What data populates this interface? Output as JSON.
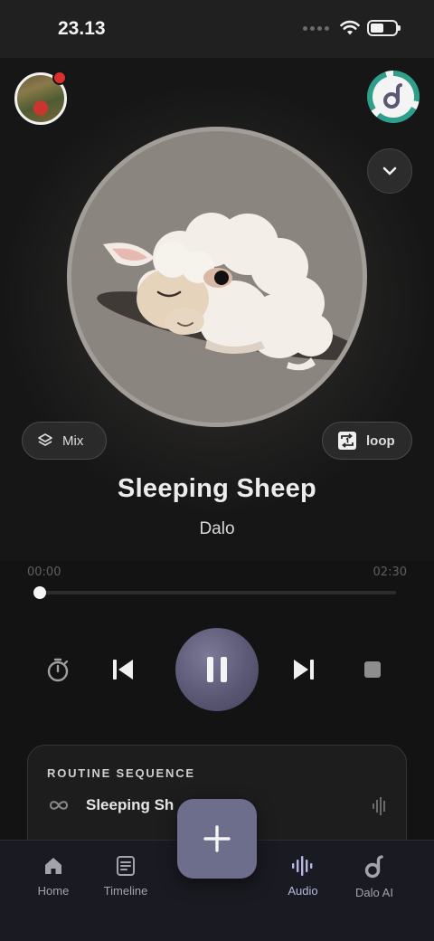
{
  "status_bar": {
    "time": "23.13"
  },
  "header": {
    "avatar_icon": "profile-photo",
    "notification_dot": true,
    "brand_icon": "dalo-logo-icon",
    "collapse_icon": "chevron-down-icon"
  },
  "player": {
    "artwork_icon": "sleeping-sheep-illustration",
    "mix_label": "Mix",
    "loop_label": "loop",
    "title": "Sleeping Sheep",
    "artist": "Dalo",
    "elapsed": "00:00",
    "total": "02:30",
    "progress": 0,
    "state": "playing",
    "controls": [
      "timer-icon",
      "previous-icon",
      "pause-icon",
      "next-icon",
      "stop-icon"
    ]
  },
  "routine": {
    "heading": "ROUTINE SEQUENCE",
    "track": "Sleeping Sheep",
    "track_visible": "Sleeping Sh"
  },
  "bottom_nav": {
    "items": [
      {
        "label": "Home",
        "icon": "home-icon"
      },
      {
        "label": "Timeline",
        "icon": "timeline-icon"
      },
      {
        "label": "Audio",
        "icon": "audio-wave-icon",
        "active": true
      },
      {
        "label": "Dalo AI",
        "icon": "dalo-ai-icon"
      }
    ],
    "fab_icon": "plus-icon"
  },
  "colors": {
    "background": "#131313",
    "play_button": "#5a5874",
    "fab": "#6c6e8c",
    "active_nav": "#b5b8e0",
    "brand_teal": "#2f9e8a",
    "notification": "#d9302b"
  }
}
